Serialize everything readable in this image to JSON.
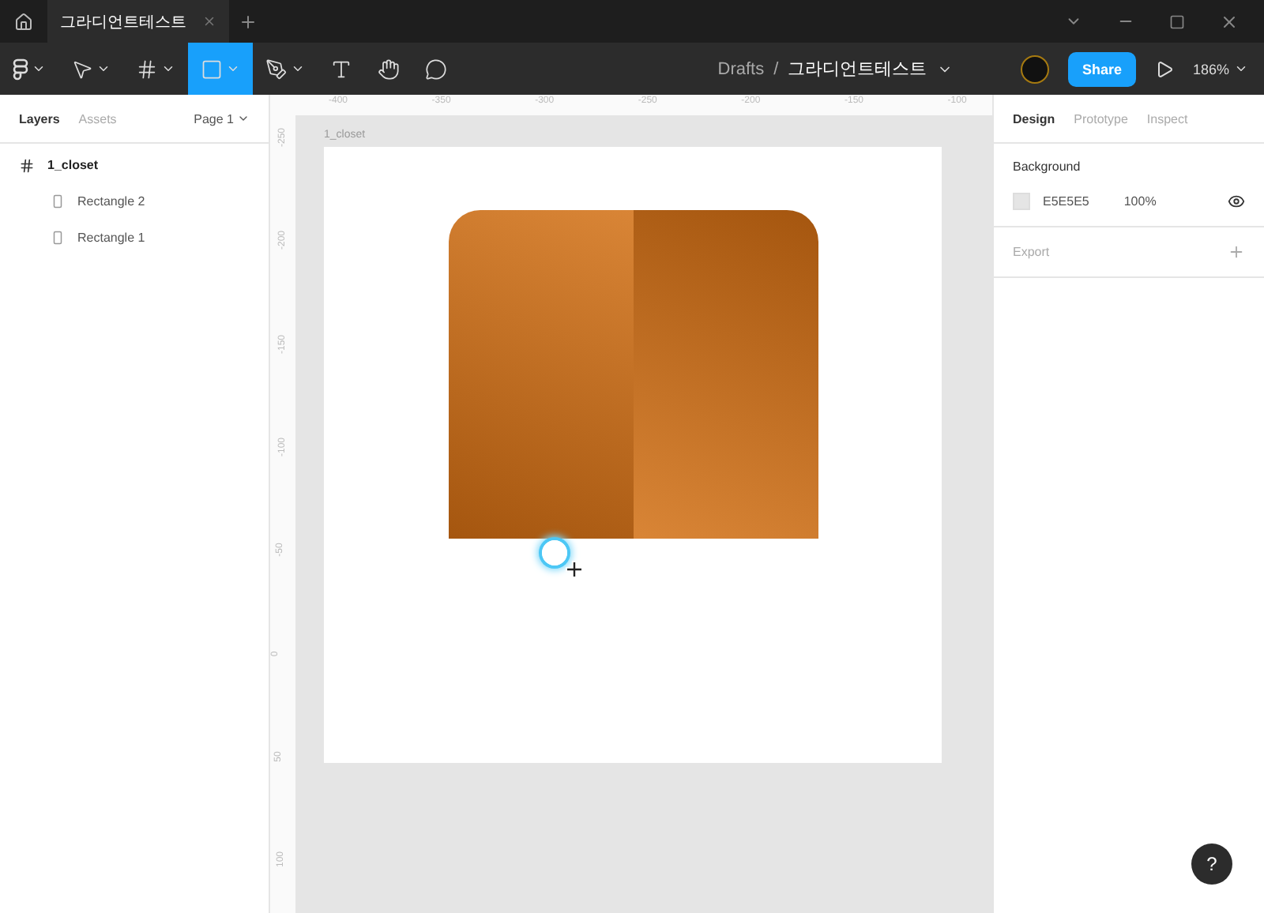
{
  "tabs": [
    {
      "label": "그라디언트테스트",
      "selected": true
    }
  ],
  "toolbar": {
    "tools": [
      {
        "kind": "logo",
        "selected": false
      },
      {
        "kind": "move",
        "selected": false
      },
      {
        "kind": "frame",
        "selected": false
      },
      {
        "kind": "rectangle",
        "selected": true
      },
      {
        "kind": "pen",
        "selected": false
      },
      {
        "kind": "text",
        "selected": false
      },
      {
        "kind": "hand",
        "selected": false
      },
      {
        "kind": "comment",
        "selected": false
      }
    ],
    "breadcrumb": "Drafts",
    "separator": "/",
    "file": "그라디언트테스트",
    "share": "Share",
    "zoom": "186%"
  },
  "left_panel": {
    "tabs": [
      {
        "label": "Layers",
        "selected": true
      },
      {
        "label": "Assets",
        "selected": false
      }
    ],
    "page": "Page 1",
    "layers": [
      {
        "name": "1_closet",
        "kind": "frame",
        "children": [
          {
            "name": "Rectangle 2",
            "kind": "rectangle"
          },
          {
            "name": "Rectangle 1",
            "kind": "rectangle"
          }
        ]
      }
    ]
  },
  "canvas": {
    "xticks": [
      "-400",
      "-350",
      "-300",
      "-250",
      "-200",
      "-150",
      "-100"
    ],
    "yticks": [
      "-250",
      "-200",
      "-150",
      "-100",
      "-50",
      "0",
      "50",
      "100"
    ],
    "frame_label": "1_closet"
  },
  "right_panel": {
    "tabs": [
      {
        "label": "Design",
        "selected": true
      },
      {
        "label": "Prototype",
        "selected": false
      },
      {
        "label": "Inspect",
        "selected": false
      }
    ],
    "background": {
      "title": "Background",
      "color": "#e5e5e5",
      "hex": "E5E5E5",
      "opacity": "100%"
    },
    "export": "Export"
  },
  "help": "?"
}
